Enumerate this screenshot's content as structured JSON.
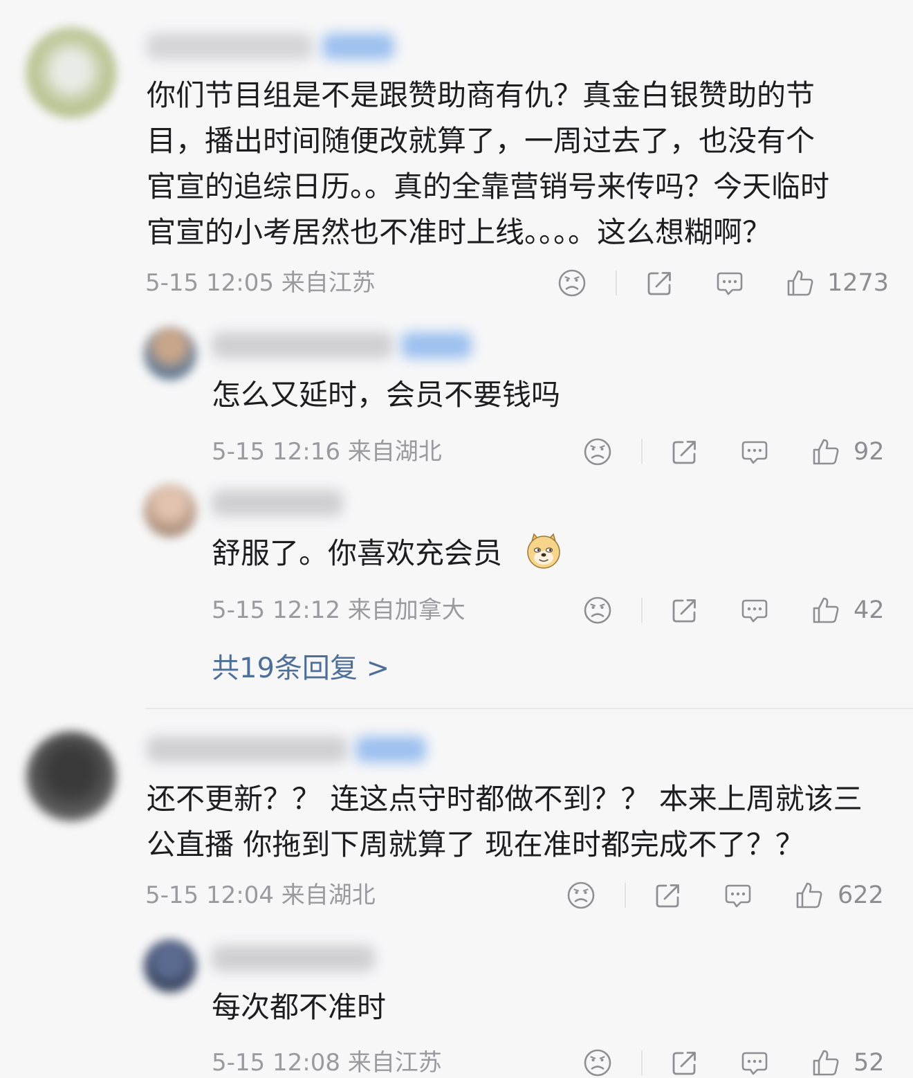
{
  "comments": [
    {
      "lines": [
        "你们节目组是不是跟赞助商有仇？真金白银赞助的节",
        "目，播出时间随便改就算了，一周过去了，也没有个",
        "官宣的追综日历。。真的全靠营销号来传吗？今天临时",
        "官宣的小考居然也不准时上线。。。。这么想糊啊？"
      ],
      "meta": "5-15 12:05 来自江苏",
      "likes": "1273",
      "replies": [
        {
          "text": "怎么又延时，会员不要钱吗",
          "meta": "5-15 12:16 来自湖北",
          "likes": "92"
        },
        {
          "text": "舒服了。你喜欢充会员",
          "emoji": "doge-emoji",
          "meta": "5-15 12:12 来自加拿大",
          "likes": "42"
        }
      ],
      "more_replies": "共19条回复 >"
    },
    {
      "lines": [
        "还不更新？？ 连这点守时都做不到？？ 本来上周就该三",
        "公直播 你拖到下周就算了 现在准时都完成不了？？"
      ],
      "meta": "5-15 12:04 来自湖北",
      "likes": "622",
      "replies": [
        {
          "text": "每次都不准时",
          "meta": "5-15 12:08 来自江苏",
          "likes": "52"
        }
      ]
    }
  ],
  "colors": {
    "link": "#4e6f97",
    "meta": "#9a9a9e",
    "text": "#1d1d1f",
    "icon": "#8f8f93",
    "vip": "#9cc0ef"
  },
  "icons": [
    "dislike-face-icon",
    "share-icon",
    "comment-icon",
    "thumbs-up-icon"
  ]
}
